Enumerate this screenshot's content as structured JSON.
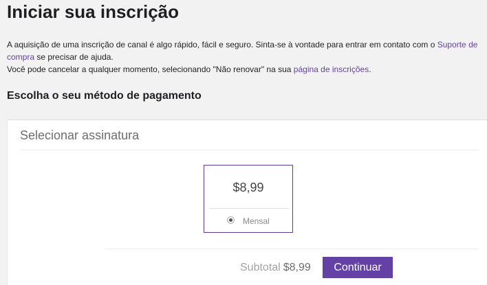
{
  "page": {
    "title": "Iniciar sua inscrição"
  },
  "intro": {
    "line1_before_link": "A aquisição de uma inscrição de canal é algo rápido, fácil e seguro. Sinta-se à vontade para entrar em contato com o ",
    "support_link": "Suporte de compra",
    "line1_after_link": " se precisar de ajuda.",
    "line2_before_link": "Você pode cancelar a qualquer momento, selecionando \"Não renovar\" na sua ",
    "subscriptions_link": "página de inscrições",
    "line2_after_link": "."
  },
  "payment": {
    "heading": "Escolha o seu método de pagamento"
  },
  "subscription": {
    "title": "Selecionar assinatura",
    "plan": {
      "price": "$8,99",
      "period": "Mensal",
      "selected": true
    }
  },
  "footer": {
    "subtotal_label": "Subtotal",
    "subtotal_value": "$8,99",
    "continue_label": "Continuar"
  },
  "colors": {
    "accent": "#6441a4",
    "link": "#6441a4",
    "background": "#f2f2f2"
  }
}
